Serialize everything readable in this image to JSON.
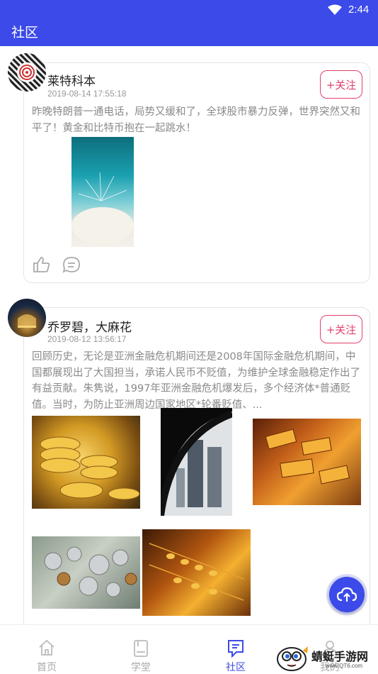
{
  "status_bar": {
    "time": "2:44"
  },
  "app_bar": {
    "title": "社区"
  },
  "posts": [
    {
      "username": "莱特科本",
      "date": "2019-08-14 17:55:18",
      "follow_label": "+关注",
      "text": "昨晚特朗普一通电话，局势又缓和了，全球股市暴力反弹，世界突然又和平了！黄金和比特币抱在一起跳水！",
      "images": [
        "dandelion-photo"
      ]
    },
    {
      "username": "乔罗碧，大麻花",
      "date": "2019-08-12 13:56:17",
      "follow_label": "+关注",
      "text": "回顾历史，无论是亚洲金融危机期间还是2008年国际金融危机期间，中国都展现出了大国担当，承诺人民币不贬值，为维护全球金融稳定作出了有益贡献。朱隽说，1997年亚洲金融危机爆发后，多个经济体*普通贬值。当时，为防止亚洲周边国家地区*轮番贬值、...",
      "images": [
        "gold-coins-photo",
        "skyscrapers-photo",
        "gold-bars-photo",
        "coins-dollars-photo",
        "abacus-photo"
      ]
    }
  ],
  "tab_bar": {
    "tabs": [
      {
        "label": "首页",
        "icon": "home-icon"
      },
      {
        "label": "学堂",
        "icon": "book-icon"
      },
      {
        "label": "社区",
        "icon": "community-icon",
        "active": true
      },
      {
        "label": "我的",
        "icon": "profile-icon"
      }
    ]
  },
  "watermark": {
    "brand": "蜻蜓手游网",
    "url": "www.QT6.com"
  },
  "colors": {
    "primary": "#3b4ae8",
    "follow": "#e0406a",
    "muted_text": "#8a8a8a"
  }
}
